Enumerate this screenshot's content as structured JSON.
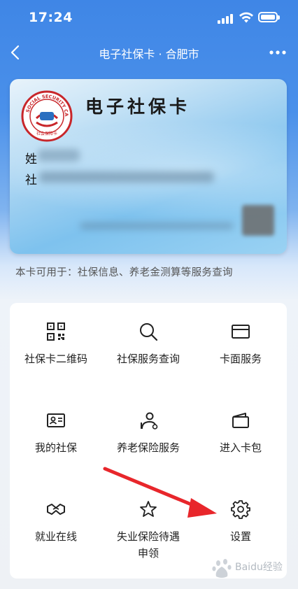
{
  "status_bar": {
    "time": "17:24"
  },
  "nav": {
    "title": "电子社保卡 · 合肥市"
  },
  "card": {
    "title": "电子社保卡",
    "emblem_ring_text": "SOCIAL SECURITY CARD",
    "emblem_inner_text": "社会保障卡",
    "name_label_prefix": "姓",
    "id_label_prefix": "社"
  },
  "usage_text": "本卡可用于：社保信息、养老金测算等服务查询",
  "services": [
    {
      "label": "社保卡二维码",
      "icon": "qr-code-icon"
    },
    {
      "label": "社保服务查询",
      "icon": "search-icon"
    },
    {
      "label": "卡面服务",
      "icon": "card-icon"
    },
    {
      "label": "我的社保",
      "icon": "id-card-icon"
    },
    {
      "label": "养老保险服务",
      "icon": "elder-person-icon"
    },
    {
      "label": "进入卡包",
      "icon": "wallet-icon"
    },
    {
      "label": "就业在线",
      "icon": "handshake-icon"
    },
    {
      "label": "失业保险待遇申领",
      "icon": "star-icon"
    },
    {
      "label": "设置",
      "icon": "gear-icon"
    }
  ],
  "colors": {
    "header_blue": "#3f86e6",
    "annotation_arrow": "#e8262b",
    "emblem_red": "#c8262a"
  },
  "watermark": {
    "text": "Baidu经验"
  }
}
